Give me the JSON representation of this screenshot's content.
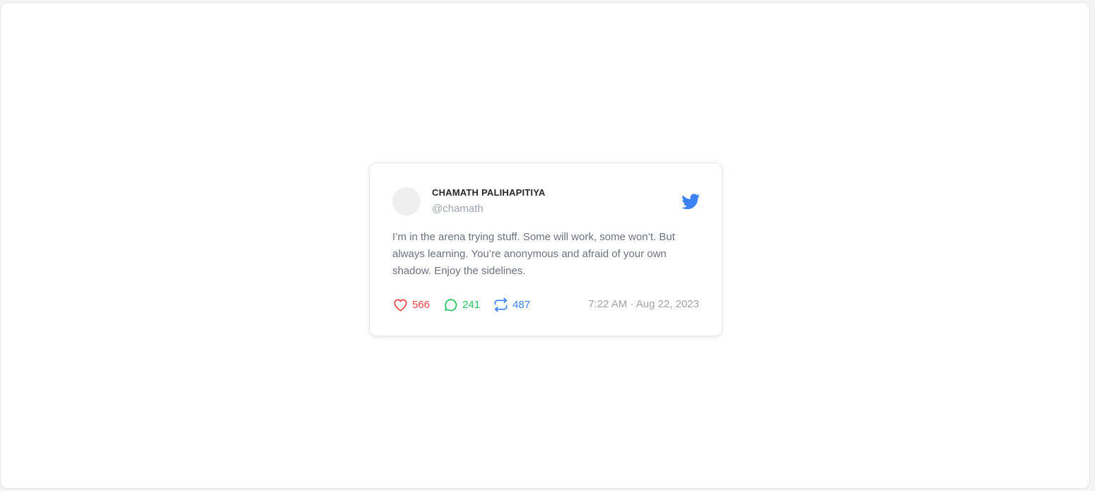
{
  "tweet": {
    "author_name": "CHAMATH PALIHAPITIYA",
    "author_handle": "@chamath",
    "text": "I’m in the arena trying stuff. Some will work, some won’t. But always learning. You’re anonymous and afraid of your own shadow. Enjoy the sidelines.",
    "likes": "566",
    "replies": "241",
    "retweets": "487",
    "timestamp": "7:22 AM · Aug 22, 2023",
    "icons": {
      "brand": "twitter-bird-icon",
      "likes": "heart-icon",
      "replies": "speech-bubble-icon",
      "retweets": "retweet-icon"
    }
  },
  "colors": {
    "brand": "#3b82f6",
    "likes": "#ef4444",
    "replies": "#22c55e",
    "retweets": "#3b82f6",
    "text": "#6b7280",
    "muted": "#9ca3af"
  }
}
